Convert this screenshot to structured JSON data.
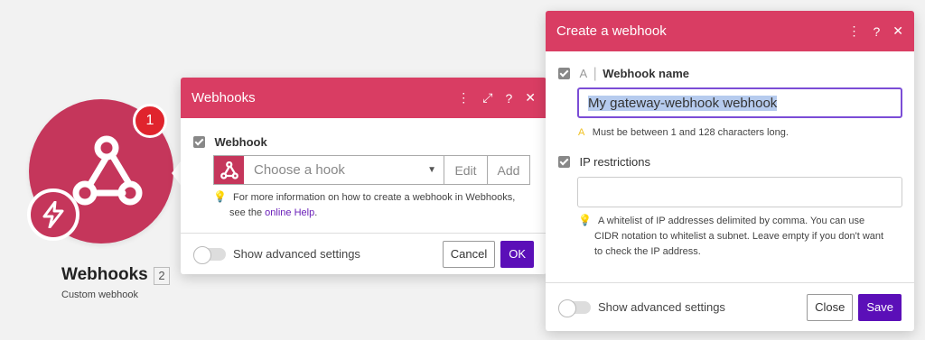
{
  "module": {
    "badge": "1",
    "title": "Webhooks",
    "count": "2",
    "subtitle": "Custom webhook",
    "color": "#c5365b"
  },
  "webhooks_panel": {
    "title": "Webhooks",
    "header_icons": [
      "more-icon",
      "expand-icon",
      "help-icon",
      "close-icon"
    ],
    "field_label": "Webhook",
    "select_placeholder": "Choose a hook",
    "edit_label": "Edit",
    "add_label": "Add",
    "hint_text": "For more information on how to create a webhook in Webhooks,",
    "hint_text2": "see the",
    "hint_link": "online Help",
    "hint_end": ".",
    "advanced_label": "Show advanced settings",
    "cancel_label": "Cancel",
    "ok_label": "OK"
  },
  "create_panel": {
    "title": "Create a webhook",
    "header_icons": [
      "more-icon",
      "help-icon",
      "close-icon"
    ],
    "name_label": "Webhook name",
    "name_type": "A",
    "name_value": "My gateway-webhook webhook",
    "name_hint": "Must be between 1 and 128 characters long.",
    "ip_label": "IP restrictions",
    "ip_value": "",
    "ip_hint_1": "A whitelist of IP addresses delimited by comma. You can use",
    "ip_hint_2": "CIDR notation to whitelist a subnet. Leave empty if you don't want",
    "ip_hint_3": "to check the IP address.",
    "advanced_label": "Show advanced settings",
    "close_label": "Close",
    "save_label": "Save"
  },
  "colors": {
    "accent": "#d93d63",
    "brand": "#c5365b",
    "primary_button": "#5b0fb8",
    "badge": "#e0242d"
  }
}
